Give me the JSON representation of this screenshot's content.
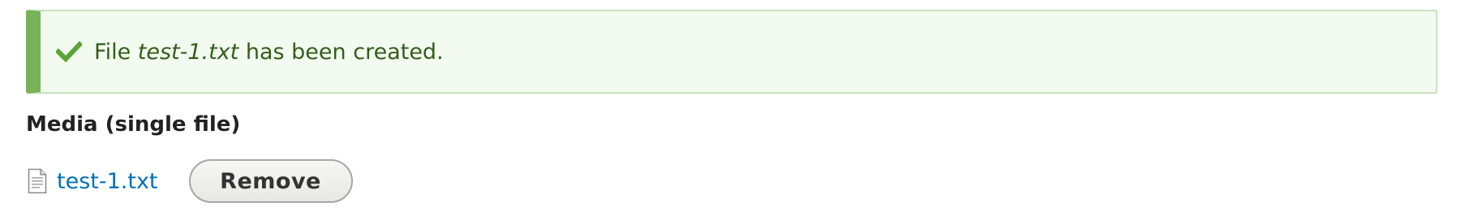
{
  "status": {
    "prefix": "File ",
    "filename": "test-1.txt",
    "suffix": " has been created.",
    "icon": "checkmark-icon",
    "accent_color": "#77b259",
    "text_color": "#325e1c"
  },
  "field": {
    "label": "Media (single file)"
  },
  "file": {
    "icon": "text-file-icon",
    "name": "test-1.txt",
    "link_color": "#0071b8"
  },
  "actions": {
    "remove_label": "Remove"
  }
}
